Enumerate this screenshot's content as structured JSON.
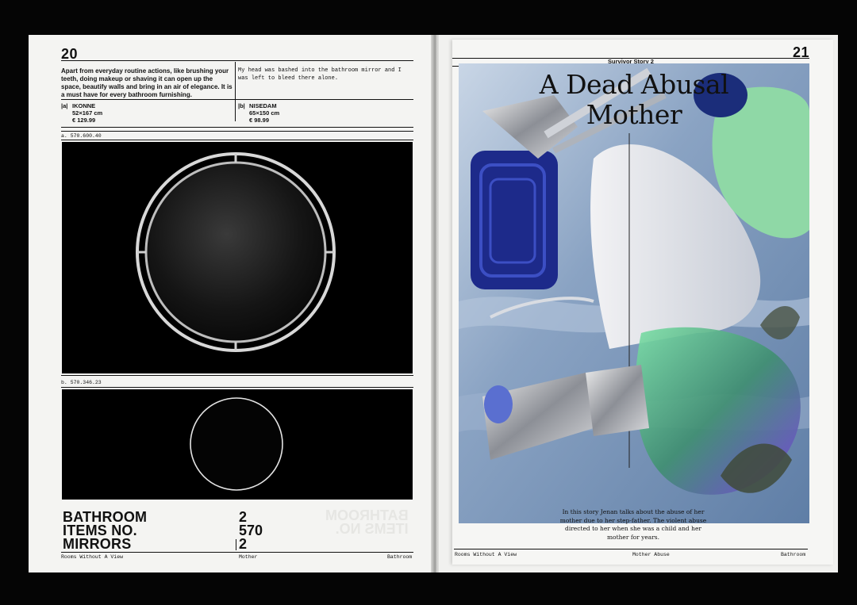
{
  "left_page": {
    "page_number": "20",
    "intro": "Apart from everyday routine actions, like brushing your teeth, doing makeup or shaving it can open up the space, beautify walls and bring in an air of elegance. It is a must have for every bathroom furnishing.",
    "quote": "My head was bashed into the bathroom mirror and I was left to bleed there alone.",
    "products": [
      {
        "key": "|a|",
        "name": "IKONNE",
        "size": "52×167 cm",
        "price": "€ 129.99"
      },
      {
        "key": "|b|",
        "name": "NISEDAM",
        "size": "65×150 cm",
        "price": "€ 98.99"
      }
    ],
    "code_a": "a. 570.600.40",
    "code_b": "b. 570.346.23",
    "title_lines": [
      "BATHROOM",
      "ITEMS NO.",
      "MIRRORS"
    ],
    "numbers": [
      "2",
      "570",
      "2"
    ],
    "footer": {
      "left": "Rooms Without A View",
      "center": "Mother",
      "right": "Bathroom"
    }
  },
  "right_page": {
    "page_number": "21",
    "story_label": "Survivor Story 2",
    "title_lines": [
      "A Dead Abusal",
      "Mother"
    ],
    "body": "In this story Jenan talks about the abuse of her mother due to her step-father. The violent abuse directed to her when she was a child and her mother for years.",
    "footer": {
      "left": "Rooms Without A View",
      "center": "Mother Abuse",
      "right": "Bathroom"
    }
  },
  "colors": {
    "paper": "#f4f4f2",
    "ink": "#111111",
    "background": "#050505",
    "art_sky": "#8ea6c4",
    "art_green": "#8fd8a6",
    "art_violet": "#6a3fc8"
  }
}
